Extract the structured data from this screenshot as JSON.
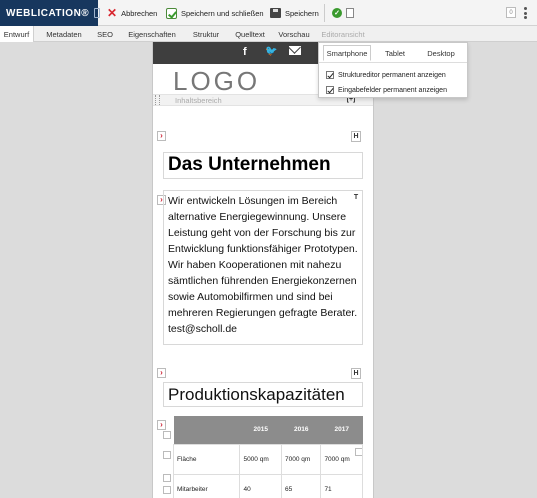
{
  "toolbar": {
    "brand": "WEBLICATION®",
    "cancel_label": "Abbrechen",
    "save_close_label": "Speichern und schließen",
    "save_label": "Speichern",
    "counter": "0"
  },
  "tabs": [
    "Entwurf",
    "Metadaten",
    "SEO",
    "Eigenschaften",
    "Struktur",
    "Quelltext",
    "Vorschau",
    "Editoransicht"
  ],
  "view_dropdown": {
    "devices": [
      "Smartphone",
      "Tablet",
      "Desktop"
    ],
    "options": [
      "Struktureditor permanent anzeigen",
      "Eingabefelder permanent anzeigen"
    ]
  },
  "page": {
    "social_icons": [
      "facebook-icon",
      "twitter-icon",
      "mail-icon"
    ],
    "logo": "LOGO",
    "area_label": "Inhaltsbereich",
    "heading": "Das Unternehmen",
    "paragraph": "Wir entwickeln Lösungen im Bereich alternative Energiegewinnung. Unsere Leistung geht von der Forschung bis zur Entwicklung funktionsfähiger Prototypen. Wir haben Kooperationen mit nahezu sämtlichen führenden Energiekonzernen sowie Automobilfirmen und sind bei mehreren Regierungen gefragte Berater. test@scholl.de",
    "heading2": "Produktionskapazitäten",
    "table": {
      "headers": [
        "",
        "2015",
        "2016",
        "2017"
      ],
      "rows": [
        [
          "Fläche",
          "5000 qm",
          "7000 qm",
          "7000 qm"
        ],
        [
          "Mitarbeiter",
          "40",
          "65",
          "71"
        ]
      ]
    }
  },
  "colors": {
    "brand": "#17375e",
    "cancel": "#d8262e",
    "ok": "#3a9a2e",
    "social_bar": "#3e3e3e"
  }
}
